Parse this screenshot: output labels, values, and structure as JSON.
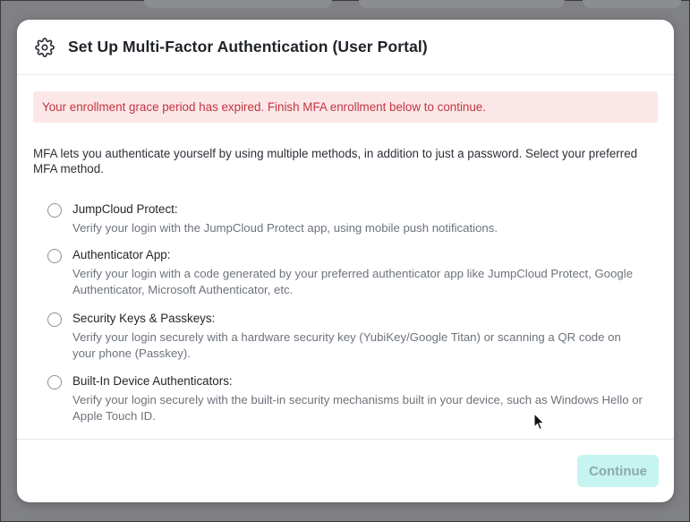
{
  "modal": {
    "title": "Set Up Multi-Factor Authentication (User Portal)",
    "icon": "gear-icon"
  },
  "alert": {
    "text": "Your enrollment grace period has expired. Finish MFA enrollment below to continue.",
    "color": "#c0363f",
    "background": "#fce7e8"
  },
  "intro": "MFA lets you authenticate yourself by using multiple methods, in addition to just a password. Select your preferred MFA method.",
  "methods": [
    {
      "label": "JumpCloud Protect:",
      "description": "Verify your login with the JumpCloud Protect app, using mobile push notifications.",
      "selected": false
    },
    {
      "label": "Authenticator App:",
      "description": "Verify your login with a code generated by your preferred authenticator app like JumpCloud Protect, Google Authenticator, Microsoft Authenticator, etc.",
      "selected": false
    },
    {
      "label": "Security Keys & Passkeys:",
      "description": "Verify your login securely with a hardware security key (YubiKey/Google Titan) or scanning a QR code on your phone (Passkey).",
      "selected": false
    },
    {
      "label": "Built-In Device Authenticators:",
      "description": "Verify your login securely with the built-in security mechanisms built in your device, such as Windows Hello or Apple Touch ID.",
      "selected": false
    }
  ],
  "footer": {
    "continue_label": "Continue",
    "continue_disabled": true,
    "accent": "#c6f4f1"
  }
}
